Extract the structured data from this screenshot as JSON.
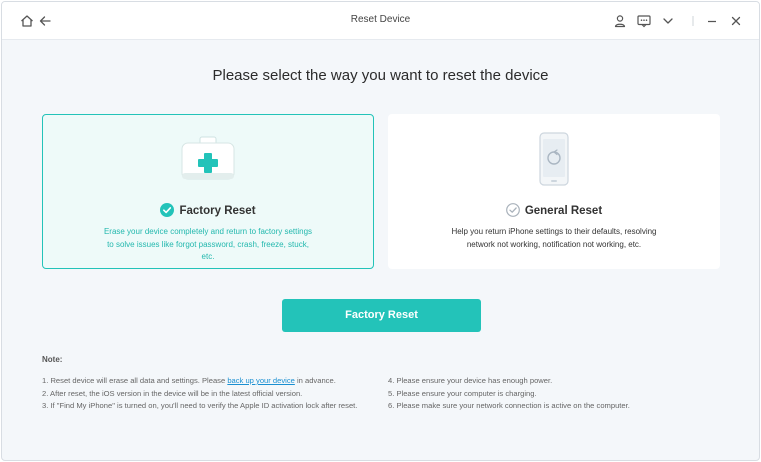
{
  "window": {
    "title": "Reset Device"
  },
  "heading": "Please select the way you want to reset the device",
  "options": [
    {
      "title": "Factory Reset",
      "description": "Erase your device completely and return to factory settings to solve issues like forgot password, crash, freeze, stuck, etc.",
      "selected": true
    },
    {
      "title": "General Reset",
      "description": "Help you return iPhone settings to their defaults, resolving network not working, notification not working, etc.",
      "selected": false
    }
  ],
  "action_button": "Factory Reset",
  "notes": {
    "title": "Note:",
    "item1_prefix": "1. Reset device will erase all data and settings. Please ",
    "item1_link": "back up your device",
    "item1_suffix": " in advance.",
    "item2": "2. After reset, the iOS version in the device will be in the latest official version.",
    "item3": "3. If \"Find My iPhone\" is turned on, you'll need to verify the Apple ID activation lock after reset.",
    "item4": "4. Please ensure your device has enough power.",
    "item5": "5. Please ensure your computer is charging.",
    "item6": "6. Please make sure your network connection is active on the computer."
  },
  "icons": {
    "home": "home-icon",
    "back": "back-arrow-icon",
    "account": "user-icon",
    "feedback": "chat-icon",
    "menu": "chevron-down-icon",
    "minimize": "minimize-icon",
    "close": "close-icon"
  },
  "colors": {
    "accent": "#23c3b9",
    "link": "#1a8fd1"
  }
}
